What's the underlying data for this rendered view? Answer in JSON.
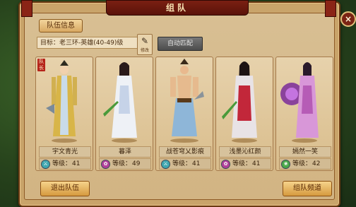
{
  "window": {
    "title": "组队"
  },
  "header": {
    "tab_label": "队伍信息"
  },
  "goal": {
    "text": "目标：老三环-英雄(40-49)级",
    "edit_label": "修改"
  },
  "auto_match_label": "自动匹配",
  "captain_badge": "队长",
  "close_icon": "×",
  "members": [
    {
      "name": "宇文青光",
      "level_label": "等级：",
      "level": "41",
      "class_icon_color": "#3fa7b0"
    },
    {
      "name": "暮泽",
      "level_label": "等级：",
      "level": "49",
      "class_icon_color": "#b0409a"
    },
    {
      "name": "战苍穹乂影痕",
      "level_label": "等级：",
      "level": "41",
      "class_icon_color": "#3fa7b0"
    },
    {
      "name": "浅墨沁红颜",
      "level_label": "等级：",
      "level": "41",
      "class_icon_color": "#b0409a"
    },
    {
      "name": "嫣然一笑",
      "level_label": "等级：",
      "level": "42",
      "class_icon_color": "#4aa84a"
    }
  ],
  "footer": {
    "leave_label": "退出队伍",
    "apply_label": "组队频道"
  },
  "colors": {
    "accent": "#7a1f12",
    "panel": "#d8bf93",
    "button_gold": "#d69a3f",
    "button_grey": "#4c4c4c"
  }
}
